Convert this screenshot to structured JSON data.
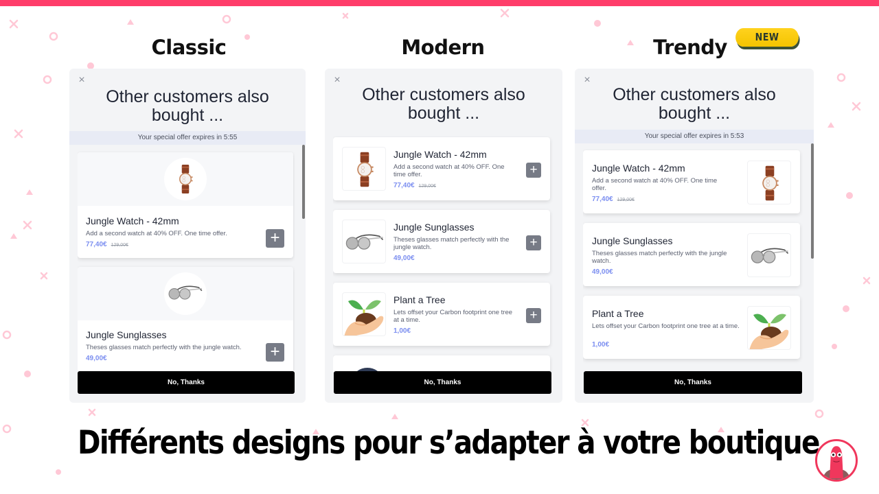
{
  "colors": {
    "accent_bar": "#ff3d6a",
    "price": "#7b8ef0",
    "add_button": "#777b86",
    "no_thanks_bg": "#000000",
    "badge_new": "#ffd21e"
  },
  "columns": [
    {
      "title": "Classic",
      "popup": {
        "heading": "Other customers also bought ...",
        "offer": "Your special offer expires in 5:55",
        "products": [
          {
            "name": "Jungle Watch - 42mm",
            "description": "Add a second watch at 40% OFF. One time offer.",
            "price": "77,40€",
            "old_price": "129,00€",
            "image": "watch",
            "add_icon": "plus-icon"
          },
          {
            "name": "Jungle Sunglasses",
            "description": "Theses glasses match perfectly with the jungle watch.",
            "price": "49,00€",
            "image": "sunglasses",
            "add_icon": "plus-icon"
          }
        ],
        "no_thanks": "No, Thanks"
      }
    },
    {
      "title": "Modern",
      "popup": {
        "heading": "Other customers also bought ...",
        "products": [
          {
            "name": "Jungle Watch - 42mm",
            "description": "Add a second watch at 40% OFF. One time offer.",
            "price": "77,40€",
            "old_price": "129,00€",
            "image": "watch",
            "add_icon": "plus-icon"
          },
          {
            "name": "Jungle Sunglasses",
            "description": "Theses glasses match perfectly with the jungle watch.",
            "price": "49,00€",
            "image": "sunglasses",
            "add_icon": "plus-icon"
          },
          {
            "name": "Plant a Tree",
            "description": "Lets offset your Carbon footprint one tree at a time.",
            "price": "1,00€",
            "image": "plant",
            "add_icon": "plus-icon"
          }
        ],
        "no_thanks": "No, Thanks"
      }
    },
    {
      "title": "Trendy",
      "badge": "NEW",
      "popup": {
        "heading": "Other customers also bought ...",
        "offer": "Your special offer expires in 5:53",
        "products": [
          {
            "name": "Jungle Watch - 42mm",
            "description": "Add a second watch at 40% OFF. One time offer.",
            "price": "77,40€",
            "old_price": "129,00€",
            "image": "watch"
          },
          {
            "name": "Jungle Sunglasses",
            "description": "Theses glasses match perfectly with the jungle watch.",
            "price": "49,00€",
            "image": "sunglasses"
          },
          {
            "name": "Plant a Tree",
            "description": "Lets offset your Carbon footprint one tree at a time.",
            "price": "1,00€",
            "image": "plant"
          }
        ],
        "no_thanks": "No, Thanks"
      }
    }
  ],
  "caption": "Différents designs pour s’adapter à votre boutique",
  "close_glyph": "×",
  "plus_glyph": "+"
}
